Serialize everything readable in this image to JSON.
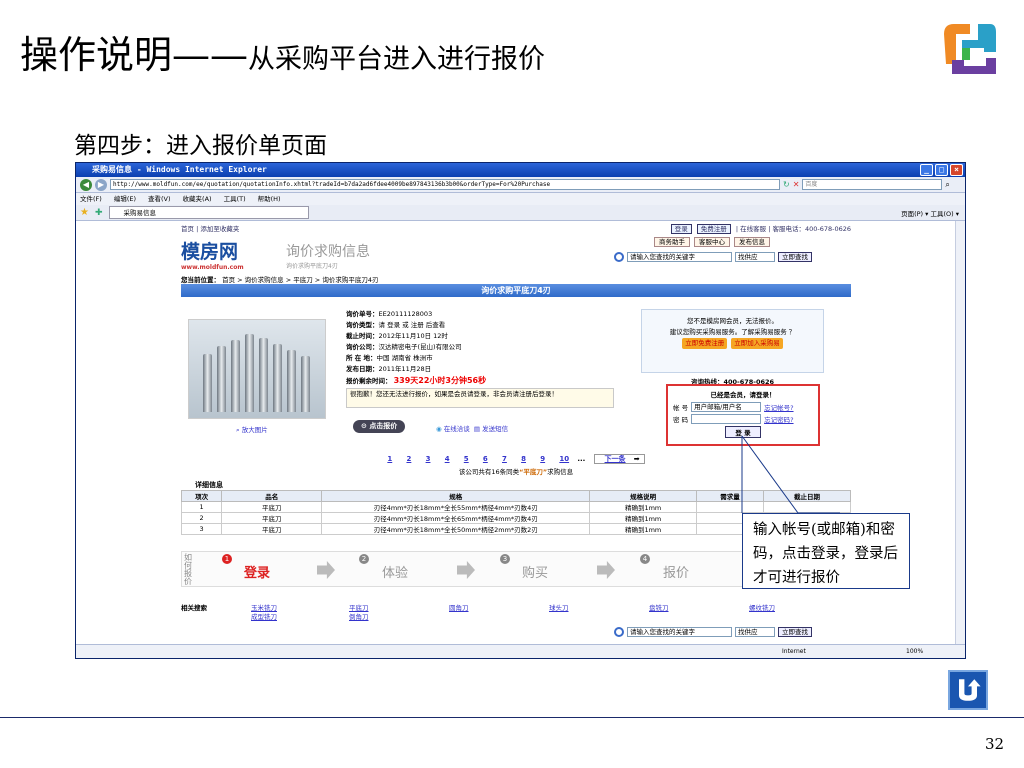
{
  "slide": {
    "title_main": "操作说明——",
    "title_sub": "从采购平台进入进行报价",
    "step": "第四步：进入报价单页面",
    "page_number": "32",
    "callout": "输入帐号(或邮箱)和密码，点击登录，登录后才可进行报价"
  },
  "browser": {
    "title": "采购易信息 - Windows Internet Explorer",
    "url": "http://www.moldfun.com/ee/quotation/quotationInfo.xhtml?tradeId=b7da2ad6fdee4009be897843136b3b00&orderType=For%20Purchase",
    "search_placeholder": "百度",
    "menu": [
      "文件(F)",
      "编辑(E)",
      "查看(V)",
      "收藏夹(A)",
      "工具(T)",
      "帮助(H)"
    ],
    "tab": "采购易信息",
    "tab_right": "页面(P) ▾ 工具(O) ▾",
    "status": "Internet",
    "zoom": "100%"
  },
  "site": {
    "top_left": "首页 | 添加至收藏夹",
    "login": "登录",
    "register": "免费注册",
    "top_right": "| 在线客服 | 客服电话：400-678-0626",
    "logo": "模房网",
    "logo_url": "www.moldfun.com",
    "subtitle": "询价求购信息",
    "subtitle_small": "询价求购平底刀4刃",
    "hdr_buttons": [
      "商务助手",
      "客服中心",
      "发布信息"
    ],
    "search_placeholder": "请输入您查找的关键字",
    "search_scope": "找供应",
    "search_btn": "立即查找",
    "crumb_label": "您当前位置：",
    "crumb": "首页 > 询价求购信息 > 平底刀 > 询价求购平底刀4刃",
    "bar_title": "询价求购平底刀4刃",
    "enlarge": "放大图片",
    "info": [
      {
        "label": "询价单号：",
        "value": "EE20111128003"
      },
      {
        "label": "询价类型：",
        "value": "请 登录 或 注册 后查看"
      },
      {
        "label": "截止时间：",
        "value": "2012年11月10日 12时"
      },
      {
        "label": "询价公司：",
        "value": "汉达精密电子(昆山)有限公司"
      },
      {
        "label": "所 在 地：",
        "value": "中国 湖南省 株洲市"
      },
      {
        "label": "发布日期：",
        "value": "2011年11月28日"
      }
    ],
    "remaining_label": "报价剩余时间：",
    "remaining": "339天22小时3分钟56秒",
    "warning": "很抱歉！您还无法进行报价，如果是会员请登录，非会员请注册后登录！",
    "quote_btn": "点击报价",
    "chat": "在线洽谈",
    "sms": "发送短信",
    "member_line1": "您不是模房网会员，无法报价。",
    "member_line2": "建议您购买采购易服务。了解采购易服务 ？",
    "member_btn1": "立即免费注册",
    "member_btn2": "立即加入采购易",
    "hotline": "咨询热线：400-678-0626",
    "login_title": "已经是会员，请登录！",
    "account_label": "帐 号",
    "account_value": "用户邮箱/用户名",
    "forgot_account": "忘记帐号?",
    "password_label": "密 码",
    "forgot_password": "忘记密码?",
    "login_btn": "登 录",
    "pages": [
      "1",
      "2",
      "3",
      "4",
      "5",
      "6",
      "7",
      "8",
      "9",
      "10"
    ],
    "pages_more": "...",
    "next": "下一条",
    "pager_note_a": "该公司共有16条同类",
    "pager_note_b": "“平底刀”",
    "pager_note_c": "求购信息",
    "detail_title": "详细信息",
    "table_head": [
      "项次",
      "品名",
      "规格",
      "规格说明",
      "需求量",
      "截止日期"
    ],
    "table_rows": [
      [
        "1",
        "平底刀",
        "刃径4mm*刃长18mm*全长55mm*柄径4mm*刃数4刃",
        "精确到1mm",
        "",
        ""
      ],
      [
        "2",
        "平底刀",
        "刃径4mm*刃长18mm*全长65mm*柄径4mm*刃数4刃",
        "精确到1mm",
        "",
        ""
      ],
      [
        "3",
        "平底刀",
        "刃径4mm*刃长18mm*全长50mm*柄径2mm*刃数2刃",
        "精确到1mm",
        "",
        ""
      ]
    ],
    "flow_side": "如何报价",
    "flow": [
      {
        "n": "1",
        "label": "登录"
      },
      {
        "n": "2",
        "label": "体验"
      },
      {
        "n": "3",
        "label": "购买"
      },
      {
        "n": "4",
        "label": "报价"
      }
    ],
    "related_label": "相关搜索",
    "related": [
      "玉米铣刀",
      "平底刀",
      "圆角刀",
      "球头刀",
      "盘铣刀",
      "螺纹铣刀",
      "成型铣刀",
      "倒角刀"
    ]
  }
}
